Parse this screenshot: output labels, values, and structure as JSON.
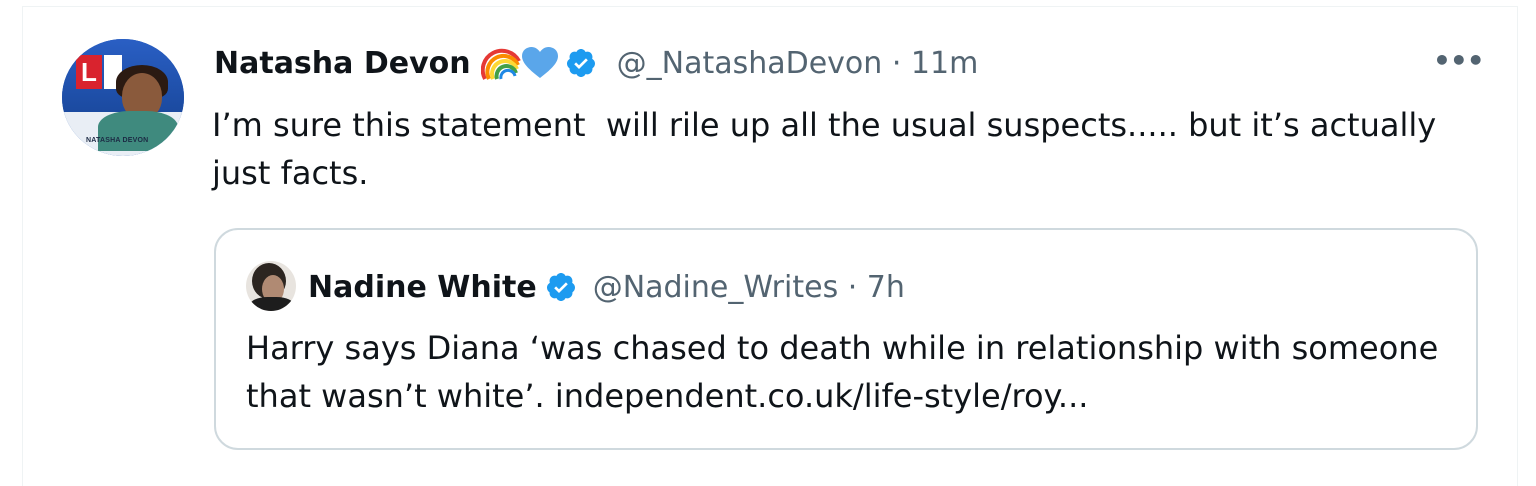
{
  "tweet": {
    "author": {
      "display_name": "Natasha Devon",
      "emoji": [
        "rainbow-emoji",
        "blue-heart-emoji"
      ],
      "verified": true,
      "avatar_caption": "NATASHA DEVON",
      "avatar_logo_letter": "L"
    },
    "handle_time": "@_NatashaDevon · 11m",
    "more_label": "•••",
    "text": "I’m sure this statement  will rile up all the usual suspects..... but it’s actually just facts.",
    "quoted": {
      "display_name": "Nadine White",
      "verified": true,
      "handle_time": "@Nadine_Writes · 7h",
      "text": "Harry says Diana ‘was chased to death while in relationship with someone that wasn’t white’. independent.co.uk/life-style/roy..."
    }
  },
  "colors": {
    "text_primary": "#0f1419",
    "text_secondary": "#536471",
    "verified_blue": "#1d9bf0",
    "border": "#cfd9de"
  }
}
